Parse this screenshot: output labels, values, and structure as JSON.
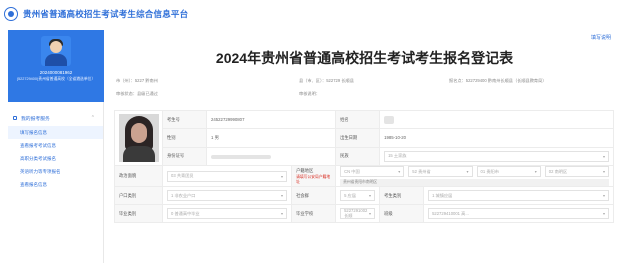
{
  "header": {
    "site_title": "贵州省普通高校招生考试考生综合信息平台"
  },
  "sidebar": {
    "profile_id": "2024000081962",
    "profile_detail": "(522729400)贵州省普通高校（全省遴选单位）",
    "menu_title": "我的报考服务",
    "menu_items": [
      {
        "label": "填写报名信息"
      },
      {
        "label": "查看报考考试信息"
      },
      {
        "label": "高职分类考试报名"
      },
      {
        "label": "英语听力等专项报名"
      },
      {
        "label": "查看报名信息"
      }
    ]
  },
  "main": {
    "help_link": "填写说明",
    "title": "2024年贵州省普通高校招生考试考生报名登记表",
    "info": {
      "city": "市（州）：5227 黔南州",
      "county": "县（市、区）：522729 长顺县",
      "point": "报名点：522729400 黔南州长顺县（长顺县教育局）",
      "status": "审核状态：县级已通过",
      "remark": "审核说明："
    },
    "form": {
      "exam_no_label": "考生号",
      "exam_no_value": "24522729990807",
      "name_label": "姓名",
      "gender_label": "性别",
      "gender_value": "1 男",
      "birth_label": "出生日期",
      "birth_value": "1985-10-20",
      "id_label": "身份证号",
      "ethnic_label": "民族",
      "ethnic_value": "15 土家族",
      "political_label": "政治面貌",
      "political_value": "03 共青团员",
      "hukou_region_label": "户籍地区",
      "hukou_region_note": "请填写公安局户籍地址",
      "hukou_country": "CN 中国",
      "hukou_province": "52 贵州省",
      "hukou_city": "01 贵阳市",
      "hukou_county": "02 南明区",
      "hukou_address": "贵州省贵阳市南明区",
      "hukou_type_label": "户口类别",
      "hukou_type_value": "1 非农业户口",
      "social_label": "社会群",
      "social_value": "5 应届",
      "category_label": "考生类别",
      "category_value": "1 城镇应届",
      "grad_type_label": "毕业类别",
      "grad_type_value": "0 普通高中毕业",
      "school_label": "毕业学校",
      "school_value": "5227291002 长顺",
      "class_label": "班级",
      "class_value": "522729410001 高..."
    }
  }
}
